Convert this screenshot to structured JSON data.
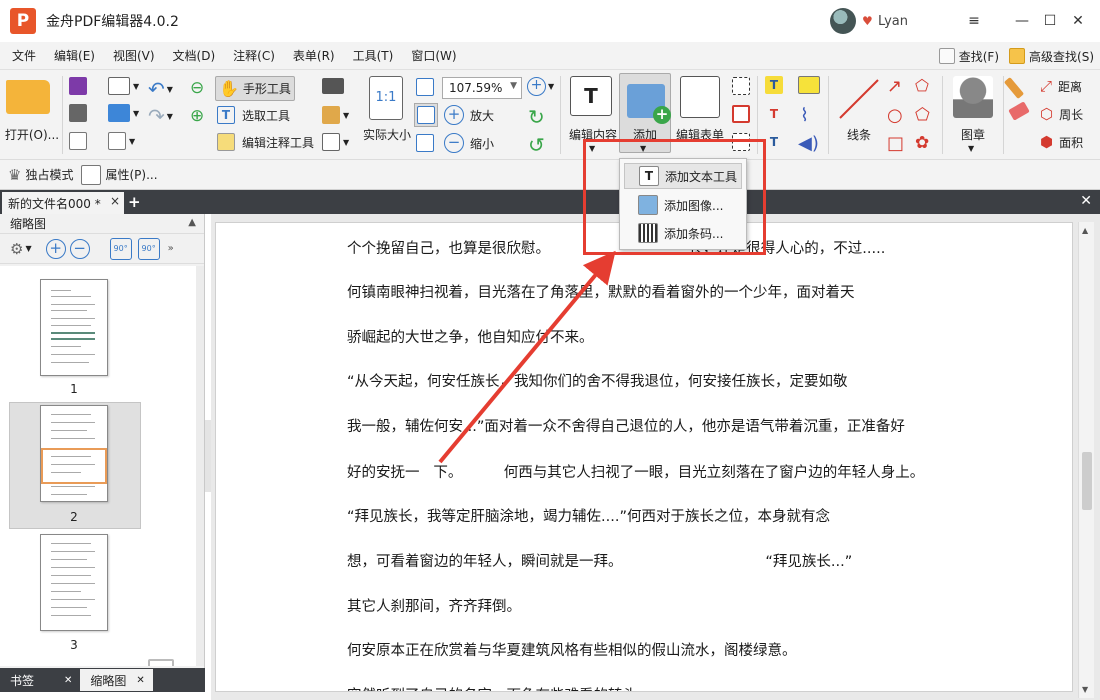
{
  "app": {
    "logo": "P",
    "title": "金舟PDF编辑器4.0.2",
    "username": "Lyan"
  },
  "window_controls": {
    "menu": "≡",
    "minimize": "—",
    "maximize": "☐",
    "close": "✕"
  },
  "menubar": {
    "items": [
      "文件",
      "编辑(E)",
      "视图(V)",
      "文档(D)",
      "注释(C)",
      "表单(R)",
      "工具(T)",
      "窗口(W)"
    ],
    "find": "查找(F)",
    "advanced_find": "高级查找(S)"
  },
  "toolbar": {
    "open": "打开(O)...",
    "hand_tool": "手形工具",
    "select_tool": "选取工具",
    "edit_annotation_tool": "编辑注释工具",
    "actual_size": "实际大小",
    "zoom_value": "107.59%",
    "zoom_in": "放大",
    "zoom_out": "缩小",
    "edit_content": "编辑内容",
    "add": "添加",
    "edit_form": "编辑表单",
    "lines": "线条",
    "stamp": "图章",
    "distance": "距离",
    "perimeter": "周长",
    "area": "面积"
  },
  "add_menu": {
    "items": [
      "添加文本工具",
      "添加图像...",
      "添加条码..."
    ]
  },
  "modebar": {
    "exclusive_mode": "独占模式",
    "properties": "属性(P)..."
  },
  "tabs": {
    "document": "新的文件名000 *",
    "close": "×",
    "add": "+",
    "close_all": "✕"
  },
  "left_panel": {
    "title": "缩略图",
    "rotate_left": "90°",
    "rotate_right": "90°",
    "pages": [
      "1",
      "2",
      "3"
    ],
    "bottom_tabs": [
      "书签",
      "缩略图"
    ]
  },
  "document": {
    "lines": [
      "个个挽留自己，也算是很欣慰。                              长，还是很得人心的，不过.....",
      "何镇南眼神扫视着，目光落在了角落里，默默的看着窗外的一个少年，面对着天",
      "骄崛起的大世之争，他自知应付不来。",
      "“从今天起，何安任族长，我知你们的舍不得我退位，何安接任族长，定要如敬",
      "我一般，辅佐何安...”面对着一众不舍得自己退位的人，他亦是语气带着沉重，正准备好",
      "好的安抚一   下。         何西与其它人扫视了一眼，目光立刻落在了窗户边的年轻人身上。",
      "“拜见族长，我等定肝脑涂地，竭力辅佐....”何西对于族长之位，本身就有念",
      "想，可看着窗边的年轻人，瞬间就是一拜。                               “拜见族长...”",
      "其它人刹那间，齐齐拜倒。",
      "何安原本正在欣赏着与华夏建筑风格有些相似的假山流水，阁楼绿意。",
      "突然听到了自己的名字，面色有些难看的转头。"
    ]
  },
  "colors": {
    "highlight_red": "#e53d31",
    "accent_blue": "#3a7ac7",
    "thumb_highlight": "#e99b57"
  }
}
